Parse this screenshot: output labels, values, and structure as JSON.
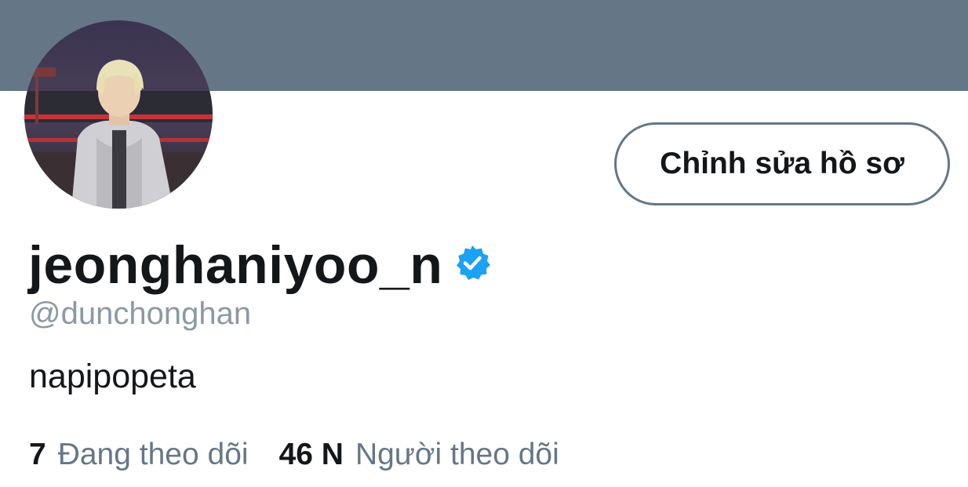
{
  "colors": {
    "banner": "#657786",
    "verified_badge": "#1da1f2",
    "text_primary": "#14171a",
    "text_secondary": "#657786"
  },
  "profile": {
    "display_name": "jeonghaniyoo_n",
    "verified_icon": "verified-badge-icon",
    "handle": "@dunchonghan",
    "bio": "napipopeta",
    "edit_button_label": "Chỉnh sửa hồ sơ",
    "avatar_icon": "profile-photo"
  },
  "stats": {
    "following_count": "7",
    "following_label": "Đang theo dõi",
    "followers_count": "46 N",
    "followers_label": "Người theo dõi"
  }
}
